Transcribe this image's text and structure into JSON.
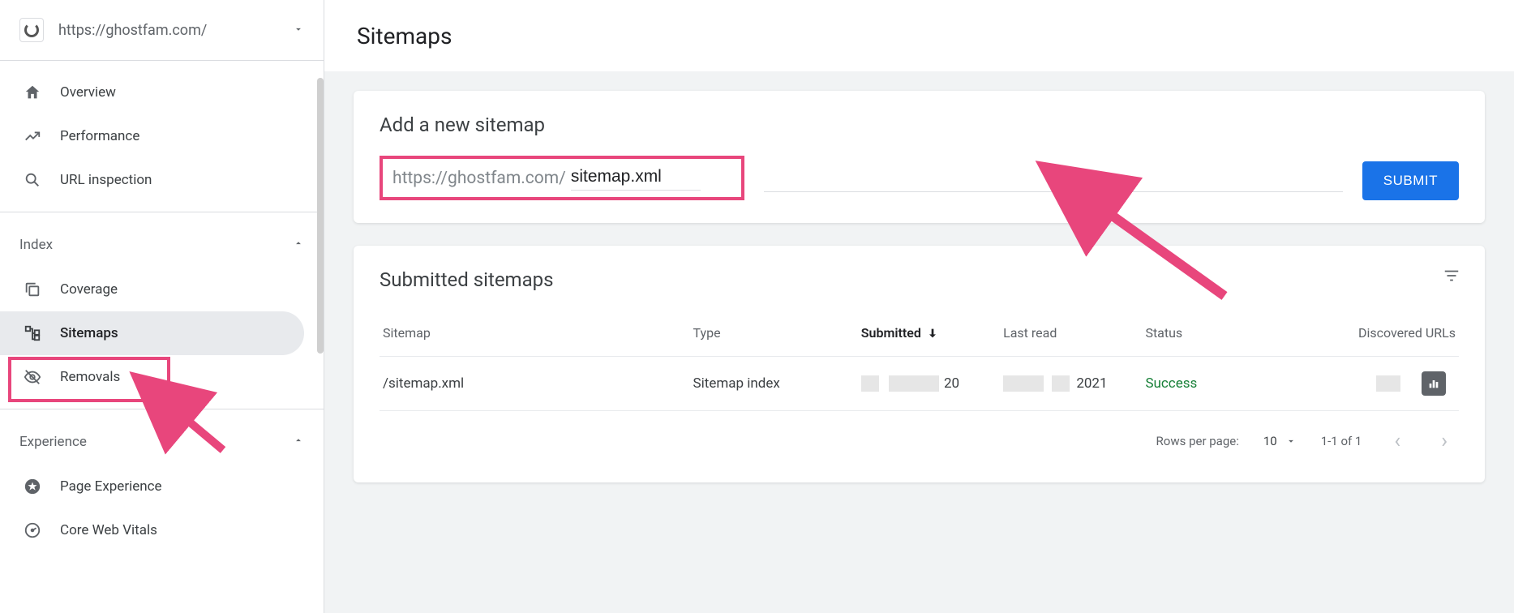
{
  "property": {
    "url": "https://ghostfam.com/"
  },
  "sidebar": {
    "top_items": [
      {
        "label": "Overview",
        "icon": "home"
      },
      {
        "label": "Performance",
        "icon": "trend"
      },
      {
        "label": "URL inspection",
        "icon": "search"
      }
    ],
    "sections": [
      {
        "label": "Index",
        "items": [
          {
            "label": "Coverage",
            "icon": "copy"
          },
          {
            "label": "Sitemaps",
            "icon": "tree",
            "active": true
          },
          {
            "label": "Removals",
            "icon": "eye-off"
          }
        ]
      },
      {
        "label": "Experience",
        "items": [
          {
            "label": "Page Experience",
            "icon": "circle-star"
          },
          {
            "label": "Core Web Vitals",
            "icon": "gauge"
          }
        ]
      }
    ]
  },
  "page": {
    "title": "Sitemaps"
  },
  "add_card": {
    "title": "Add a new sitemap",
    "prefix": "https://ghostfam.com/",
    "input_value": "sitemap.xml",
    "submit_label": "SUBMIT"
  },
  "submitted_card": {
    "title": "Submitted sitemaps",
    "columns": {
      "sitemap": "Sitemap",
      "type": "Type",
      "submitted": "Submitted",
      "last_read": "Last read",
      "status": "Status",
      "discovered": "Discovered URLs"
    },
    "rows": [
      {
        "sitemap": "/sitemap.xml",
        "type": "Sitemap index",
        "submitted_partial": "20",
        "last_read_partial": "2021",
        "status": "Success"
      }
    ],
    "pagination": {
      "rows_label": "Rows per page:",
      "rows_value": "10",
      "range": "1-1 of 1"
    }
  }
}
